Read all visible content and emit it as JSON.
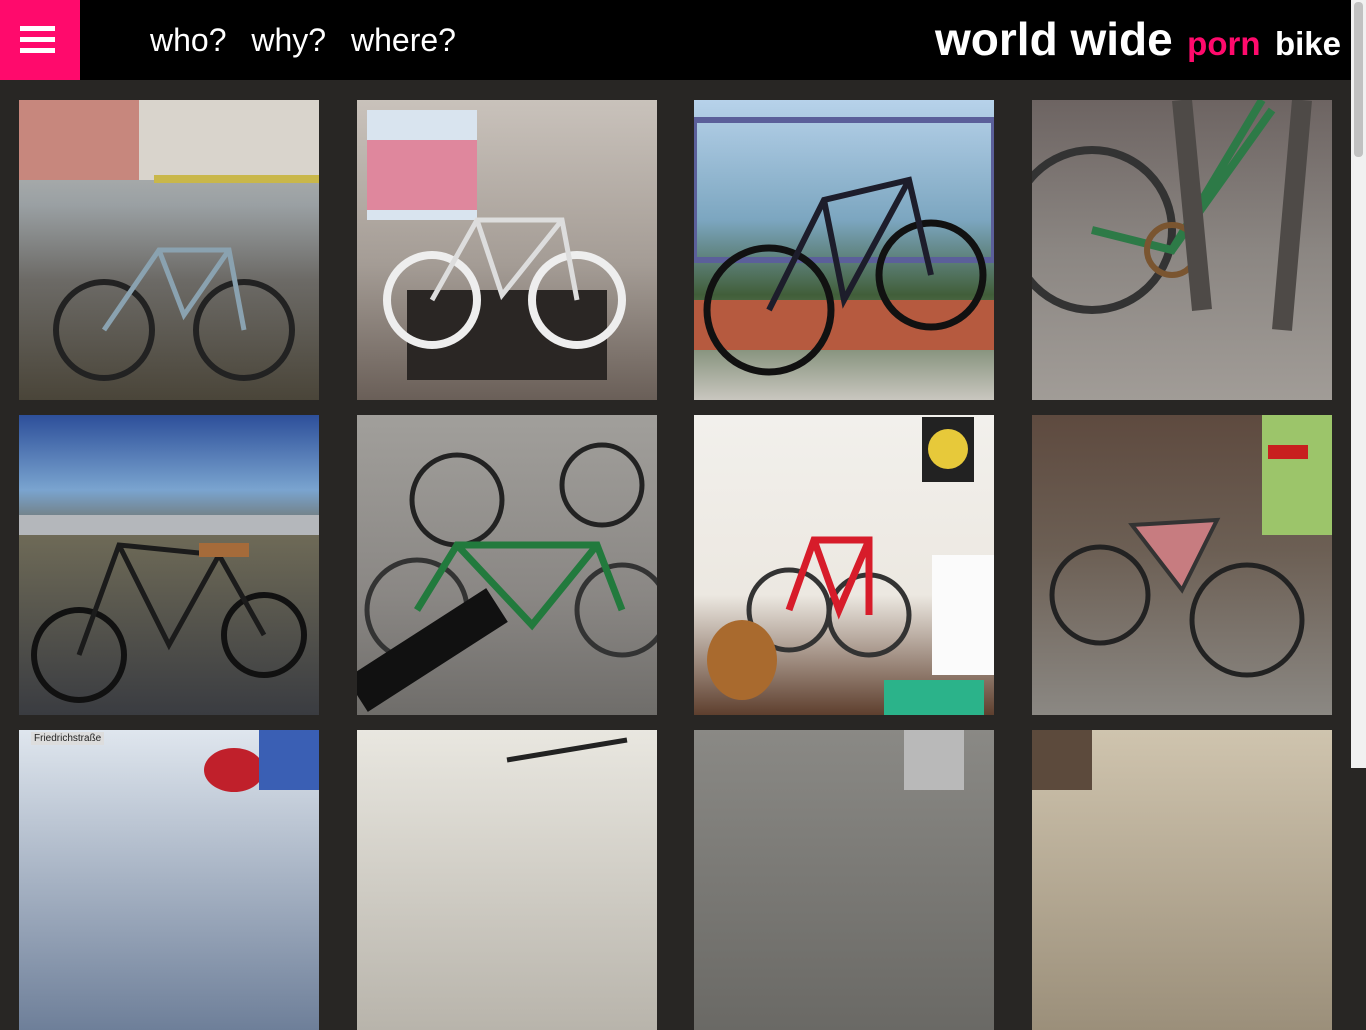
{
  "header": {
    "nav": [
      "who?",
      "why?",
      "where?"
    ],
    "logo": {
      "part1": "world wide",
      "part2": "porn",
      "part3": "bike"
    }
  },
  "colors": {
    "accent": "#ff0a6c",
    "header_bg": "#000000",
    "page_bg": "#282624"
  },
  "gallery": [
    {
      "name": "bike-photo-1",
      "caption": ""
    },
    {
      "name": "bike-photo-2",
      "caption": ""
    },
    {
      "name": "bike-photo-3",
      "caption": ""
    },
    {
      "name": "bike-photo-4",
      "caption": ""
    },
    {
      "name": "bike-photo-5",
      "caption": ""
    },
    {
      "name": "bike-photo-6",
      "caption": ""
    },
    {
      "name": "bike-photo-7",
      "caption": ""
    },
    {
      "name": "bike-photo-8",
      "caption": ""
    },
    {
      "name": "bike-photo-9",
      "caption": "Friedrichstraße"
    },
    {
      "name": "bike-photo-10",
      "caption": ""
    },
    {
      "name": "bike-photo-11",
      "caption": ""
    },
    {
      "name": "bike-photo-12",
      "caption": ""
    }
  ]
}
